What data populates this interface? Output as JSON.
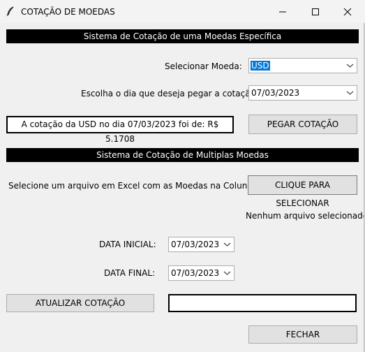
{
  "window": {
    "title": "COTAÇÃO DE MOEDAS"
  },
  "single": {
    "banner": "Sistema de Cotação de uma Moedas Específica",
    "currency_label": "Selecionar Moeda:",
    "currency_value": "USD",
    "date_label": "Escolha o dia que deseja pegar a cotação:",
    "date_value": "07/03/2023",
    "result_text": "A cotação da USD no dia 07/03/2023 foi de: R$ 5.1708",
    "get_button": "PEGAR COTAÇÃO"
  },
  "multi": {
    "banner": "Sistema de Cotação de Multiplas Moedas",
    "file_label": "Selecione um arquivo em Excel com as Moedas na Coluna A:",
    "file_button": "CLIQUE PARA SELECIONAR",
    "file_status": "Nenhum arquivo selecionado",
    "start_label": "DATA INICIAL:",
    "start_value": "07/03/2023",
    "end_label": "DATA FINAL:",
    "end_value": "07/03/2023",
    "update_button": "ATUALIZAR COTAÇÃO",
    "status_text": ""
  },
  "footer": {
    "close_button": "FECHAR"
  },
  "icons": {
    "app": "feather-icon",
    "minimize": "minimize-icon",
    "maximize": "maximize-icon",
    "close": "close-icon",
    "dropdown": "chevron-down-icon"
  },
  "colors": {
    "background": "#f0f0f0",
    "banner": "#000000",
    "selection": "#0078d7"
  }
}
